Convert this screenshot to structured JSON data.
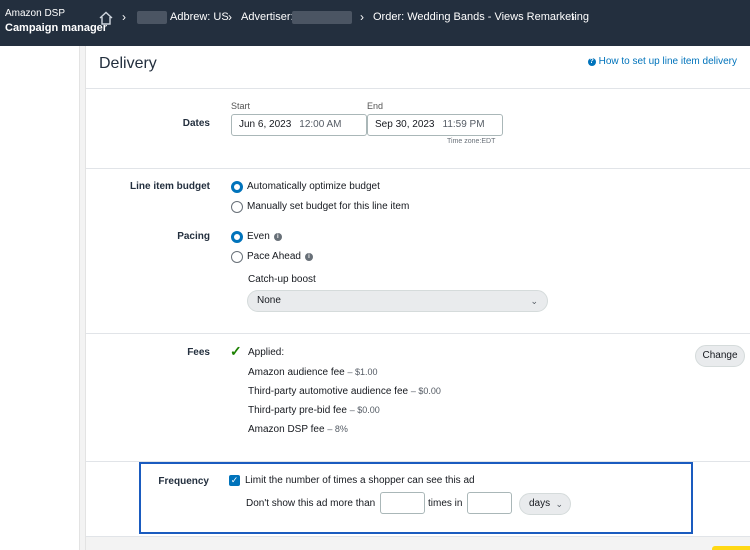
{
  "header": {
    "brand_line1": "Amazon DSP",
    "brand_line2": "Campaign manager",
    "breadcrumbs": [
      "Adbrew: US",
      "Advertiser:",
      "Order: Wedding Bands - Views Remarketing"
    ]
  },
  "delivery": {
    "title": "Delivery",
    "help_link": "How to set up line item delivery"
  },
  "dates": {
    "label": "Dates",
    "start_caption": "Start",
    "start_date": "Jun 6, 2023",
    "start_time": "12:00 AM",
    "end_caption": "End",
    "end_date": "Sep 30, 2023",
    "end_time": "11:59 PM",
    "timezone": "Time zone:EDT"
  },
  "budget": {
    "label": "Line item budget",
    "option_auto": "Automatically optimize budget",
    "option_manual": "Manually set budget for this line item"
  },
  "pacing": {
    "label": "Pacing",
    "option_even": "Even",
    "option_ahead": "Pace Ahead",
    "catchup_label": "Catch-up boost",
    "catchup_value": "None"
  },
  "fees": {
    "label": "Fees",
    "applied": "Applied:",
    "items": [
      {
        "name": "Amazon audience fee",
        "amount": "– $1.00"
      },
      {
        "name": "Third-party automotive audience fee",
        "amount": "– $0.00"
      },
      {
        "name": "Third-party pre-bid fee",
        "amount": "– $0.00"
      },
      {
        "name": "Amazon DSP fee",
        "amount": "– 8%"
      }
    ],
    "change_button": "Change"
  },
  "frequency": {
    "label": "Frequency",
    "limit_text": "Limit the number of times a shopper can see this ad",
    "dont_show": "Don't show this ad more than",
    "times_in": "times in",
    "period": "days"
  }
}
